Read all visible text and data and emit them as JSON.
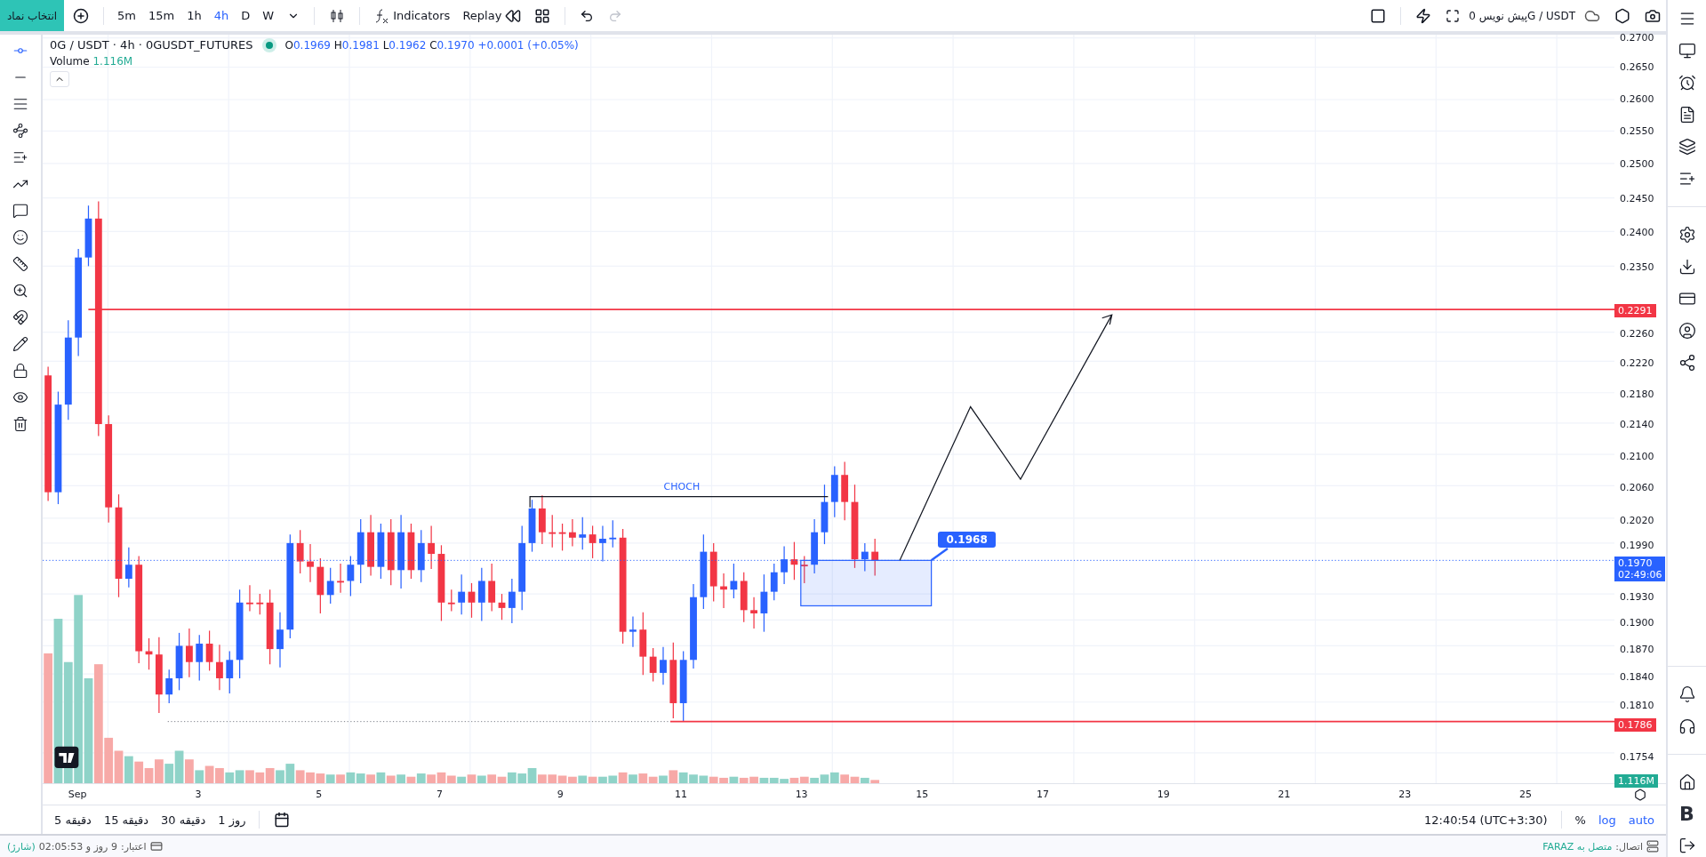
{
  "top_bar": {
    "symbol_button": "انتخاب نماد",
    "intervals": [
      {
        "label": "5m",
        "selected": false
      },
      {
        "label": "15m",
        "selected": false
      },
      {
        "label": "1h",
        "selected": false
      },
      {
        "label": "4h",
        "selected": true
      },
      {
        "label": "D",
        "selected": false
      },
      {
        "label": "W",
        "selected": false
      }
    ],
    "indicators": "Indicators",
    "replay": "Replay",
    "draft": "پیش نویس 0G / USDT"
  },
  "legend": {
    "title": "0G / USDT · 4h · 0GUSDT_FUTURES",
    "ohlc": [
      {
        "key": "O",
        "value": "0.1969"
      },
      {
        "key": "H",
        "value": "0.1981"
      },
      {
        "key": "L",
        "value": "0.1962"
      },
      {
        "key": "C",
        "value": "0.1970"
      }
    ],
    "change": "+0.0001 (+0.05%)",
    "volume_label": "Volume",
    "volume_value": "1.116M"
  },
  "chart": {
    "annotation": "CHOCH",
    "target_label": "0.1968"
  },
  "price_axis": {
    "ticks": [
      "0.2700",
      "0.2650",
      "0.2600",
      "0.2550",
      "0.2500",
      "0.2450",
      "0.2400",
      "0.2350",
      "0.2260",
      "0.2220",
      "0.2180",
      "0.2140",
      "0.2100",
      "0.2060",
      "0.2020",
      "0.1990",
      "0.1930",
      "0.1900",
      "0.1870",
      "0.1840",
      "0.1810",
      "0.1754"
    ],
    "badges": [
      {
        "text": "0.2291",
        "color": "#f23645"
      },
      {
        "text": "0.1970",
        "subtext": "02:49:06",
        "color": "#2962ff"
      },
      {
        "text": "0.1786",
        "color": "#f23645"
      },
      {
        "text": "1.116M",
        "color": "#22ab94"
      }
    ]
  },
  "time_axis": {
    "ticks": [
      "Sep",
      "3",
      "5",
      "7",
      "9",
      "11",
      "13",
      "15",
      "17",
      "19",
      "21",
      "23",
      "25"
    ]
  },
  "bottom_bar": {
    "ranges": [
      "1 روز",
      "30 دقیقه",
      "15 دقیقه",
      "5 دقیقه"
    ],
    "clock": "12:40:54 (UTC+3:30)",
    "percent": "%",
    "log": "log",
    "auto": "auto"
  },
  "status_bar": {
    "credit_label": "اعتبار:",
    "credit_value": "9 روز و 02:05:53",
    "charge": "(شارژ)",
    "connection_label": "اتصال:",
    "connection_value": "متصل به FARAZ"
  },
  "sidebar": {
    "logo_letter": "B"
  }
}
